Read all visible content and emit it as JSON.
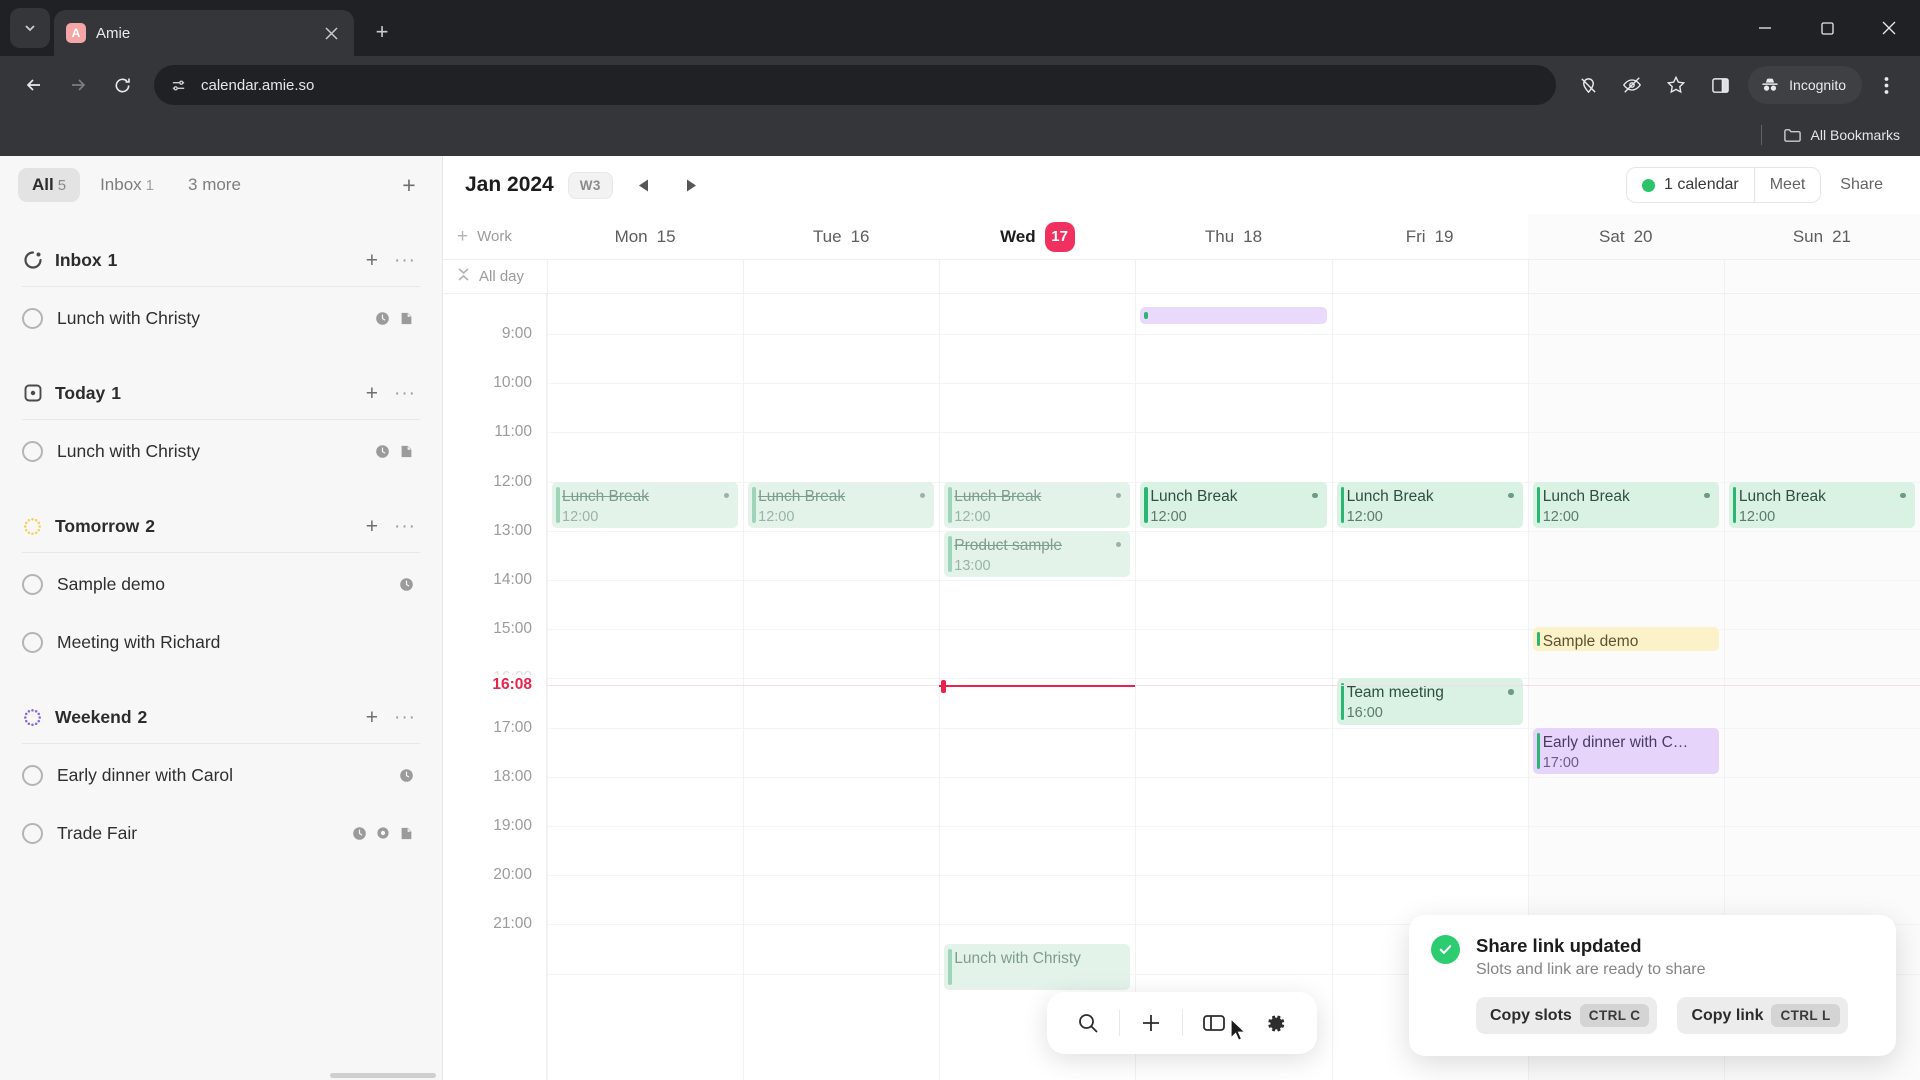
{
  "browser": {
    "tab": {
      "title": "Amie",
      "favicon_letter": "A",
      "favicon_name": "amie-favicon"
    },
    "new_tab_label": "+",
    "tab_list_icon": "chevron-down-icon",
    "window_controls": {
      "minimize": "minimize-icon",
      "maximize": "maximize-icon",
      "close": "close-icon"
    },
    "nav": {
      "back": "back-arrow-icon",
      "forward": "forward-arrow-icon",
      "reload": "reload-icon"
    },
    "omnibox": {
      "url": "calendar.amie.so",
      "site_info_icon": "site-settings-icon"
    },
    "toolbar_icons": [
      "location-blocked-icon",
      "eye-off-icon",
      "bookmark-star-icon",
      "side-panel-icon"
    ],
    "incognito": {
      "label": "Incognito",
      "icon": "incognito-hat-icon"
    },
    "menu_icon": "three-dots-menu-icon",
    "bookmarks_bar": {
      "label": "All Bookmarks",
      "icon": "folder-icon"
    }
  },
  "sidebar": {
    "tabs": [
      {
        "label": "All",
        "count": "5",
        "active": true
      },
      {
        "label": "Inbox",
        "count": "1",
        "active": false
      },
      {
        "label": "3 more",
        "count": "",
        "active": false
      }
    ],
    "add_list_label": "+",
    "groups": [
      {
        "name": "Inbox",
        "count": "1",
        "icon": "inbox-icon",
        "tasks": [
          {
            "label": "Lunch with Christy",
            "icons": [
              "clock-icon",
              "note-icon"
            ]
          }
        ]
      },
      {
        "name": "Today",
        "count": "1",
        "icon": "today-square-icon",
        "tasks": [
          {
            "label": "Lunch with Christy",
            "icons": [
              "clock-icon",
              "note-icon"
            ]
          }
        ]
      },
      {
        "name": "Tomorrow",
        "count": "2",
        "icon": "tomorrow-dotted-icon",
        "tasks": [
          {
            "label": "Sample demo",
            "icons": [
              "clock-icon"
            ]
          },
          {
            "label": "Meeting with Richard",
            "icons": []
          }
        ]
      },
      {
        "name": "Weekend",
        "count": "2",
        "icon": "weekend-dotted-icon",
        "tasks": [
          {
            "label": "Early dinner with Carol",
            "icons": [
              "clock-icon"
            ]
          },
          {
            "label": "Trade Fair",
            "icons": [
              "clock-icon",
              "circle-icon",
              "note-icon"
            ]
          }
        ]
      }
    ]
  },
  "calendar": {
    "month": "Jan 2024",
    "week_badge": "W3",
    "prev_icon": "triangle-left-icon",
    "next_icon": "triangle-right-icon",
    "calendars_label": "1 calendar",
    "meet_label": "Meet",
    "share_label": "Share",
    "accent_green": "#2bc46a",
    "today_color": "#f0315f",
    "work_row": {
      "add_icon": "plus-icon",
      "label": "Work"
    },
    "allday_row": {
      "collapse_icon": "collapse-icon",
      "label": "All day"
    },
    "days": [
      {
        "name": "Mon",
        "num": "15",
        "today": false,
        "weekend": false
      },
      {
        "name": "Tue",
        "num": "16",
        "today": false,
        "weekend": false
      },
      {
        "name": "Wed",
        "num": "17",
        "today": true,
        "weekend": false
      },
      {
        "name": "Thu",
        "num": "18",
        "today": false,
        "weekend": false
      },
      {
        "name": "Fri",
        "num": "19",
        "today": false,
        "weekend": false
      },
      {
        "name": "Sat",
        "num": "20",
        "today": false,
        "weekend": true
      },
      {
        "name": "Sun",
        "num": "21",
        "today": false,
        "weekend": true
      }
    ],
    "time_labels": [
      "9:00",
      "10:00",
      "11:00",
      "12:00",
      "13:00",
      "14:00",
      "15:00",
      "16:00",
      "17:00",
      "18:00",
      "19:00",
      "20:00",
      "21:00"
    ],
    "now_label": "16:08",
    "events": [
      {
        "day": 3,
        "title": "",
        "time": "",
        "color": "purple",
        "plain": true,
        "start": 8.45,
        "end": 8.85,
        "done": false,
        "dot": false
      },
      {
        "day": 0,
        "title": "Lunch Break",
        "time": "12:00",
        "color": "green",
        "faded": true,
        "start": 12,
        "end": 13,
        "done": true,
        "dot": true
      },
      {
        "day": 1,
        "title": "Lunch Break",
        "time": "12:00",
        "color": "green",
        "faded": true,
        "start": 12,
        "end": 13,
        "done": true,
        "dot": true
      },
      {
        "day": 2,
        "title": "Lunch Break",
        "time": "12:00",
        "color": "green",
        "faded": true,
        "start": 12,
        "end": 13,
        "done": true,
        "dot": true
      },
      {
        "day": 2,
        "title": "Product sample",
        "time": "13:00",
        "color": "green",
        "faded": true,
        "start": 13,
        "end": 14,
        "done": true,
        "dot": true
      },
      {
        "day": 3,
        "title": "Lunch Break",
        "time": "12:00",
        "color": "green",
        "start": 12,
        "end": 13,
        "done": false,
        "dot": true
      },
      {
        "day": 4,
        "title": "Lunch Break",
        "time": "12:00",
        "color": "green",
        "start": 12,
        "end": 13,
        "done": false,
        "dot": true
      },
      {
        "day": 5,
        "title": "Lunch Break",
        "time": "12:00",
        "color": "green",
        "start": 12,
        "end": 13,
        "done": false,
        "dot": true
      },
      {
        "day": 6,
        "title": "Lunch Break",
        "time": "12:00",
        "color": "green",
        "start": 12,
        "end": 13,
        "done": false,
        "dot": true
      },
      {
        "day": 5,
        "title": "Sample demo",
        "time": "",
        "color": "yellow",
        "start": 14.95,
        "end": 15.5,
        "done": false,
        "dot": false
      },
      {
        "day": 4,
        "title": "Team meeting",
        "time": "16:00",
        "color": "green",
        "start": 16,
        "end": 17,
        "done": false,
        "dot": true
      },
      {
        "day": 5,
        "title": "Early dinner with Carol",
        "time": "17:00",
        "color": "purple",
        "start": 17,
        "end": 18,
        "done": false,
        "dot": false
      },
      {
        "day": 2,
        "title": "Lunch with Christy",
        "time": "",
        "color": "green",
        "faded": true,
        "start": 21.4,
        "end": 22.4,
        "done": false,
        "dot": false
      }
    ]
  },
  "dock": {
    "buttons": [
      {
        "name": "search-icon"
      },
      {
        "name": "add-icon"
      },
      {
        "name": "panel-toggle-icon"
      },
      {
        "name": "settings-gear-icon"
      }
    ]
  },
  "toast": {
    "icon": "success-check-icon",
    "title": "Share link updated",
    "subtitle": "Slots and link are ready to share",
    "buttons": [
      {
        "label": "Copy slots",
        "shortcut": "CTRL C"
      },
      {
        "label": "Copy link",
        "shortcut": "CTRL L"
      }
    ]
  }
}
